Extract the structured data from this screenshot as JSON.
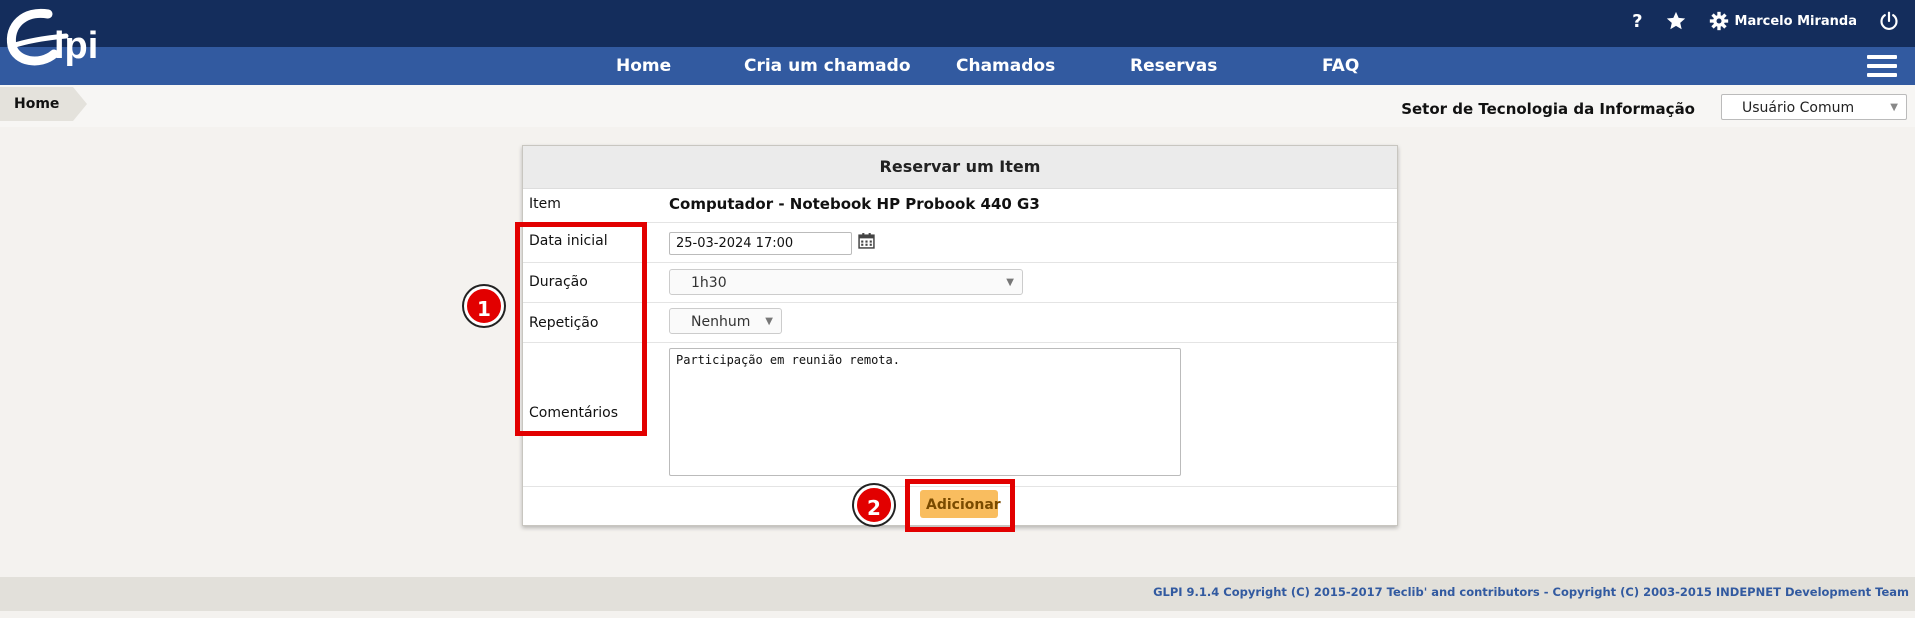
{
  "app": {
    "logo_text": "Glpi"
  },
  "header": {
    "help_label": "?",
    "user_name": "Marcelo Miranda"
  },
  "nav": {
    "items": [
      "Home",
      "Cria um chamado",
      "Chamados",
      "Reservas",
      "FAQ"
    ]
  },
  "breadcrumb": {
    "home": "Home"
  },
  "entity": {
    "name": "Setor de Tecnologia da Informação"
  },
  "profile": {
    "selected": "Usuário Comum"
  },
  "form": {
    "title": "Reservar um Item",
    "item_label": "Item",
    "item_value": "Computador - Notebook HP Probook 440 G3",
    "start_label": "Data inicial",
    "start_value": "25-03-2024 17:00",
    "duration_label": "Duração",
    "duration_value": "1h30",
    "repeat_label": "Repetição",
    "repeat_value": "Nenhum",
    "comments_label": "Comentários",
    "comments_value": "Participação em reunião remota.",
    "submit_label": "Adicionar"
  },
  "annotations": {
    "marker_1": "1",
    "marker_2": "2"
  },
  "colors": {
    "topbar": "#142d5c",
    "navbar": "#325aa0",
    "submit_button": "#f9bd5f",
    "highlight": "#e20000"
  },
  "footer": {
    "text": "GLPI 9.1.4 Copyright (C) 2015-2017 Teclib' and contributors - Copyright (C) 2003-2015 INDEPNET Development Team"
  }
}
